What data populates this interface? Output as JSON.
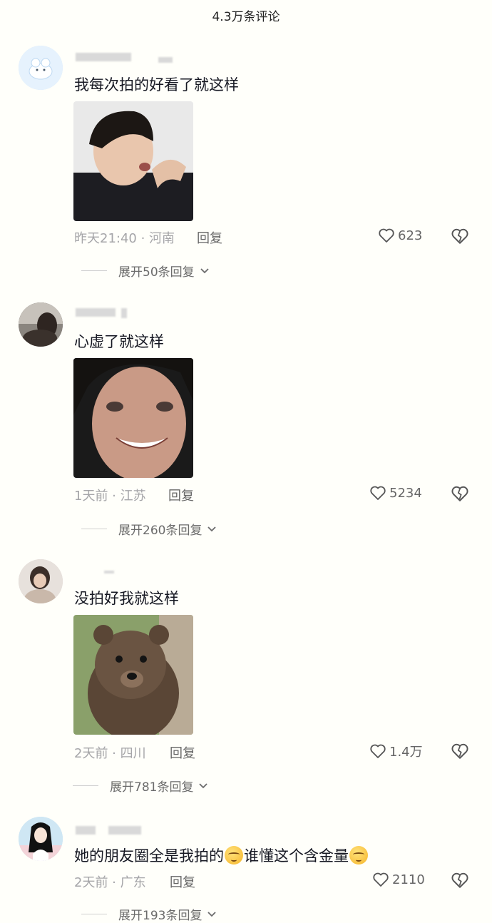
{
  "header": {
    "title": "4.3万条评论"
  },
  "comments": [
    {
      "text": "我每次拍的好看了就这样",
      "time_location": "昨天21:40 · 河南",
      "reply_label": "回复",
      "likes": "623",
      "expand_label": "展开50条回复"
    },
    {
      "text": "心虚了就这样",
      "time_location": "1天前 · 江苏",
      "reply_label": "回复",
      "likes": "5234",
      "expand_label": "展开260条回复"
    },
    {
      "text": "没拍好我就这样",
      "time_location": "2天前 · 四川",
      "reply_label": "回复",
      "likes": "1.4万",
      "expand_label": "展开781条回复"
    },
    {
      "text_part1": "她的朋友圈全是我拍的",
      "text_part2": "谁懂这个含金量",
      "emoji": "relieved-face-emoji",
      "time_location": "2天前 · 广东",
      "reply_label": "回复",
      "likes": "2110",
      "expand_label": "展开193条回复"
    }
  ],
  "colors": {
    "background": "#fffffa",
    "text": "#161823",
    "meta": "#a5a5a8"
  },
  "icons": [
    "heart-icon",
    "broken-heart-icon",
    "chevron-down-icon"
  ]
}
